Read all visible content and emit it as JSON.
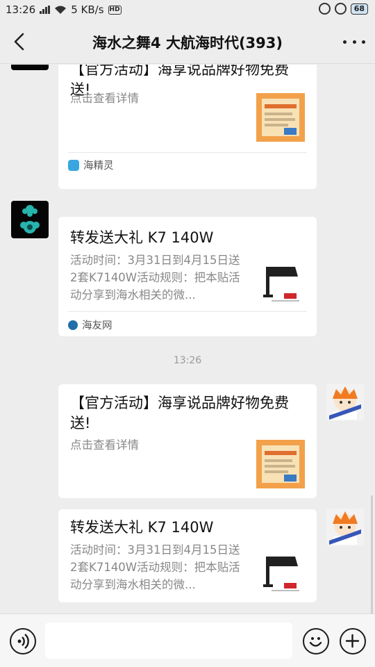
{
  "status_bar": {
    "time": "13:26",
    "network_speed": "5 KB/s",
    "hd_badge": "HD",
    "battery": "68"
  },
  "header": {
    "title": "海水之舞4 大航海时代(393)",
    "back_icon": "chevron-left-icon",
    "more_icon": "more-dots-icon"
  },
  "messages": [
    {
      "sender": "dark-flower-avatar",
      "title": "【官方活动】海享说品牌好物免费送!",
      "description": "点击查看详情",
      "source": "海精灵"
    },
    {
      "sender": "dark-flower-avatar",
      "title": "转发送大礼 K7 140W",
      "description": "活动时间：3月31日到4月15日送2套K7140W活动规则：把本贴活动分享到海水相关的微...",
      "source": "海友网"
    },
    {
      "sender": "self-avatar",
      "title": "【官方活动】海享说品牌好物免费送!",
      "description": "点击查看详情"
    },
    {
      "sender": "self-avatar",
      "title": "转发送大礼 K7 140W",
      "description": "活动时间：3月31日到4月15日送2套K7140W活动规则：把本贴活动分享到海水相关的微..."
    }
  ],
  "timestamp": "13:26",
  "bottom_bar": {
    "voice_icon": "voice-input-icon",
    "emoji_icon": "emoji-icon",
    "add_icon": "add-icon",
    "input_value": ""
  },
  "colors": {
    "background": "#ededed",
    "card": "#ffffff",
    "secondary_text": "#888888",
    "source_icon_1": "#3aa6e0",
    "source_icon_2": "#1f6fa8"
  }
}
